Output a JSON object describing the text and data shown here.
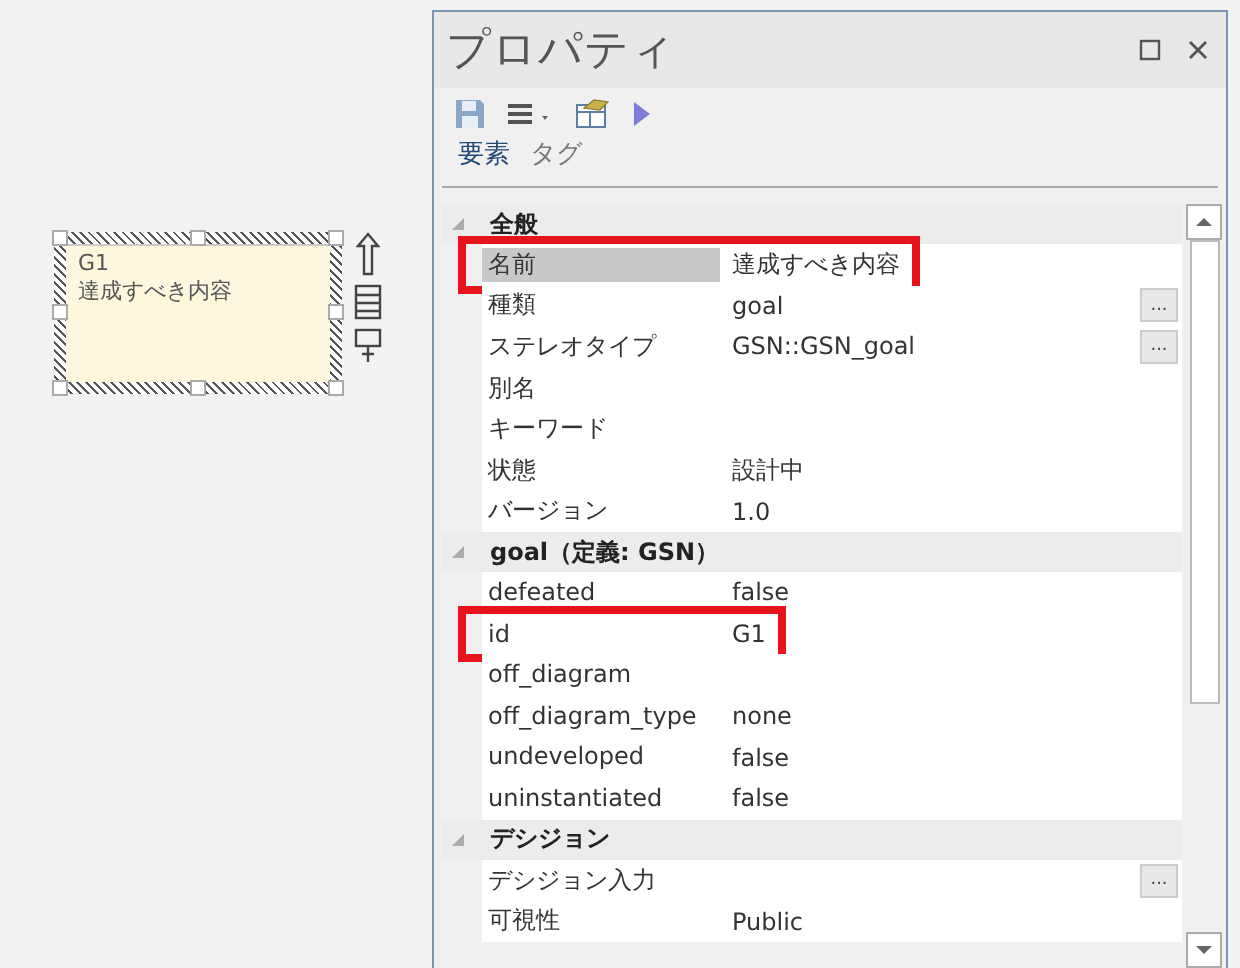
{
  "canvas": {
    "element": {
      "code": "G1",
      "name": "達成すべき内容",
      "selected": true
    }
  },
  "panel": {
    "title": "プロパティ",
    "tabs": [
      {
        "label": "要素",
        "selected": true
      },
      {
        "label": "タグ",
        "selected": false
      }
    ],
    "sections": [
      {
        "title": "全般",
        "expanded": true,
        "rows": [
          {
            "label": "名前",
            "value": "達成すべき内容",
            "selected": true,
            "highlighted": true
          },
          {
            "label": "種類",
            "value": "goal",
            "selected": false,
            "highlighted": false,
            "button": "..."
          },
          {
            "label": "ステレオタイプ",
            "value": "GSN::GSN_goal",
            "selected": false,
            "highlighted": false,
            "button": "..."
          },
          {
            "label": "別名",
            "selected": false,
            "highlighted": false
          },
          {
            "label": "キーワード",
            "selected": false,
            "highlighted": false
          },
          {
            "label": "状態",
            "value": "設計中",
            "selected": false,
            "highlighted": false
          },
          {
            "label": "バージョン",
            "value": "1.0",
            "selected": false,
            "highlighted": false
          }
        ]
      },
      {
        "title": "goal（定義: GSN）",
        "expanded": true,
        "rows": [
          {
            "label": "defeated",
            "value": "false",
            "selected": false,
            "highlighted": false
          },
          {
            "label": "id",
            "value": "G1",
            "selected": false,
            "highlighted": true
          },
          {
            "label": "off_diagram",
            "selected": false,
            "highlighted": false
          },
          {
            "label": "off_diagram_type",
            "value": "none",
            "selected": false,
            "highlighted": false
          },
          {
            "label": "undeveloped",
            "value": "false",
            "selected": false,
            "highlighted": false
          },
          {
            "label": "uninstantiated",
            "value": "false",
            "selected": false,
            "highlighted": false
          }
        ]
      },
      {
        "title": "デシジョン",
        "expanded": true,
        "rows": [
          {
            "label": "デシジョン入力",
            "selected": false,
            "highlighted": false,
            "button": "..."
          },
          {
            "label": "可視性",
            "value": "Public",
            "selected": false,
            "highlighted": false
          }
        ]
      }
    ]
  }
}
